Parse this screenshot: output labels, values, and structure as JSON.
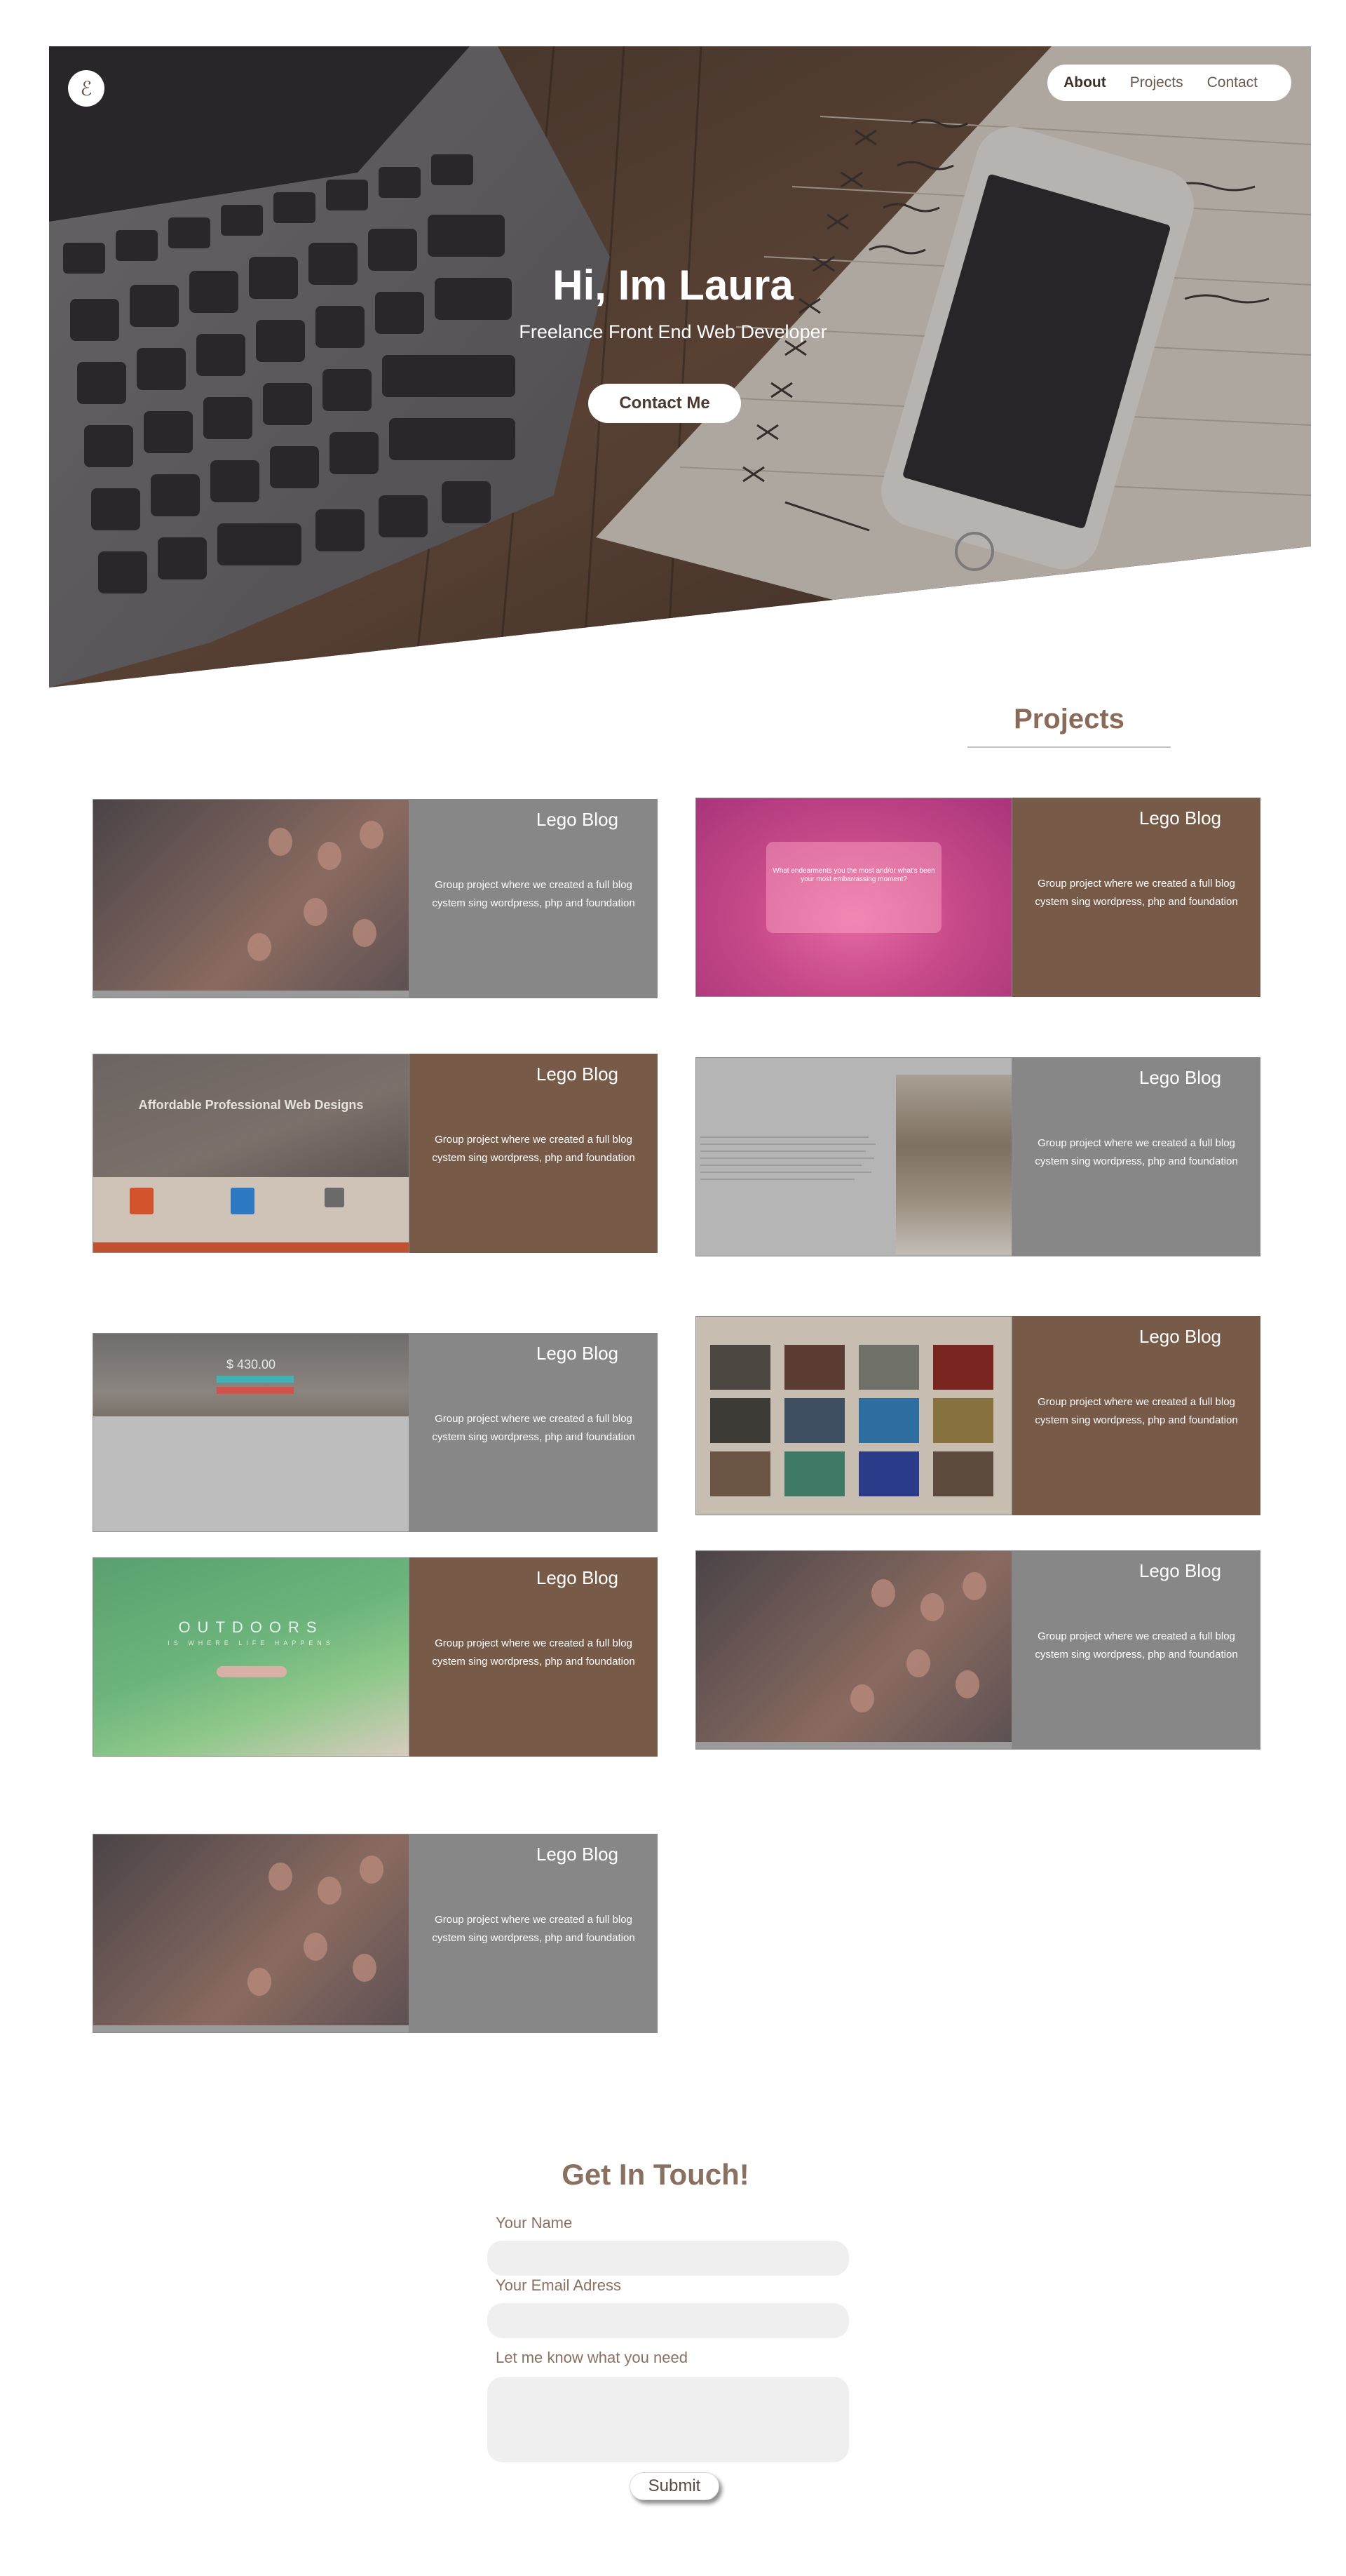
{
  "logo": {
    "glyph": "ℰ"
  },
  "nav": {
    "items": [
      {
        "label": "About",
        "active": true
      },
      {
        "label": "Projects",
        "active": false
      },
      {
        "label": "Contact",
        "active": false
      }
    ]
  },
  "hero": {
    "title": "Hi, Im Laura",
    "subtitle": "Freelance Front End Web Developer",
    "cta": "Contact Me"
  },
  "projects": {
    "heading": "Projects",
    "items": [
      {
        "title": "Lego Blog",
        "description": "Group project where we created a full blog cystem sing wordpress, php and foundation"
      },
      {
        "title": "Lego Blog",
        "description": "Group project where we created a full blog cystem sing wordpress, php and foundation"
      },
      {
        "title": "Lego Blog",
        "description": "Group project where we created a full blog cystem sing wordpress, php and foundation"
      },
      {
        "title": "Lego Blog",
        "description": "Group project where we created a full blog cystem sing wordpress, php and foundation"
      },
      {
        "title": "Lego Blog",
        "description": "Group project where we created a full blog cystem sing wordpress, php and foundation"
      },
      {
        "title": "Lego Blog",
        "description": "Group project where we created a full blog cystem sing wordpress, php and foundation"
      },
      {
        "title": "Lego Blog",
        "description": "Group project where we created a full blog cystem sing wordpress, php and foundation"
      },
      {
        "title": "Lego Blog",
        "description": "Group project where we created a full blog cystem sing wordpress, php and foundation"
      },
      {
        "title": "Lego Blog",
        "description": "Group project where we created a full blog cystem sing wordpress, php and foundation"
      }
    ]
  },
  "thumbs": {
    "pink_text": "What endearments you the most and/or what's been your most embarrassing moment?",
    "web_headline": "Affordable Professional Web Designs",
    "mtn_price": "$ 430.00",
    "green_word": "OUTDOORS",
    "green_sub": "IS WHERE LIFE HAPPENS"
  },
  "contact": {
    "heading": "Get In Touch!",
    "name_label": "Your Name",
    "email_label": "Your Email Adress",
    "message_label": "Let me know what you need",
    "name_value": "",
    "email_value": "",
    "message_value": "",
    "submit": "Submit"
  },
  "colors": {
    "brown": "#775a48",
    "grey": "#878787",
    "accent": "#8a6b5a"
  }
}
